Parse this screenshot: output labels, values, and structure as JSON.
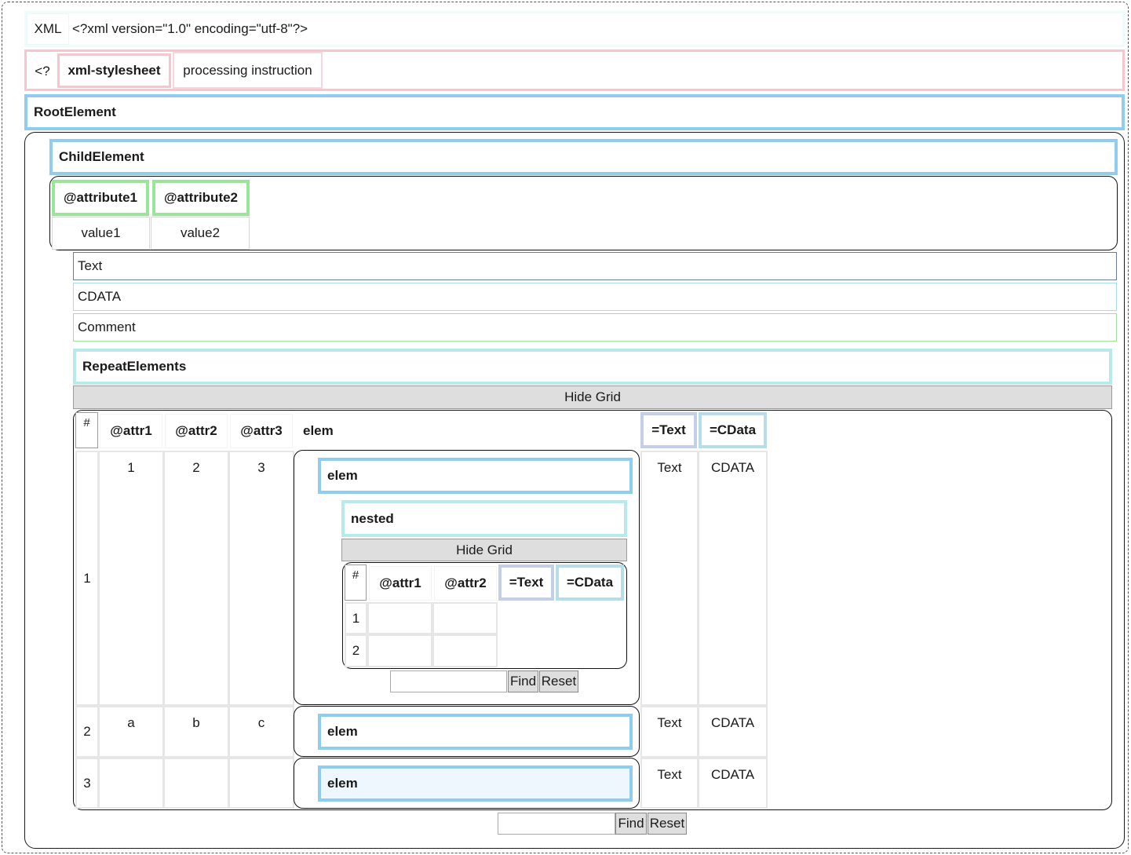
{
  "xml_decl": {
    "tag": "XML",
    "text": "<?xml version=\"1.0\" encoding=\"utf-8\"?>"
  },
  "pi": {
    "open": "<?",
    "name": "xml-stylesheet",
    "desc": "processing instruction"
  },
  "root": {
    "name": "RootElement"
  },
  "child": {
    "name": "ChildElement",
    "attributes": [
      {
        "name": "@attribute1",
        "value": "value1"
      },
      {
        "name": "@attribute2",
        "value": "value2"
      }
    ],
    "text": "Text",
    "cdata": "CDATA",
    "comment": "Comment"
  },
  "repeat": {
    "name": "RepeatElements",
    "hide_grid": "Hide Grid",
    "headers": {
      "num": "#",
      "attr1": "@attr1",
      "attr2": "@attr2",
      "attr3": "@attr3",
      "elem": "elem",
      "text": "=Text",
      "cdata": "=CData"
    },
    "rows": [
      {
        "num": "1",
        "attr1": "1",
        "attr2": "2",
        "attr3": "3",
        "elem": "elem",
        "text": "Text",
        "cdata": "CDATA"
      },
      {
        "num": "2",
        "attr1": "a",
        "attr2": "b",
        "attr3": "c",
        "elem": "elem",
        "text": "Text",
        "cdata": "CDATA"
      },
      {
        "num": "3",
        "attr1": "",
        "attr2": "",
        "attr3": "",
        "elem": "elem",
        "text": "Text",
        "cdata": "CDATA"
      }
    ],
    "nested": {
      "name": "nested",
      "hide_grid": "Hide Grid",
      "headers": {
        "num": "#",
        "attr1": "@attr1",
        "attr2": "@attr2",
        "text": "=Text",
        "cdata": "=CData"
      },
      "rows": [
        {
          "num": "1"
        },
        {
          "num": "2"
        }
      ],
      "find": "Find",
      "reset": "Reset"
    },
    "find": "Find",
    "reset": "Reset"
  },
  "colors": {
    "element_border": "#8ecdef",
    "attribute_border": "#99e599",
    "pi_border": "#f8c4ce",
    "repeat_border": "#b7eaea",
    "selected_elem_bg": "#eef7fd"
  }
}
